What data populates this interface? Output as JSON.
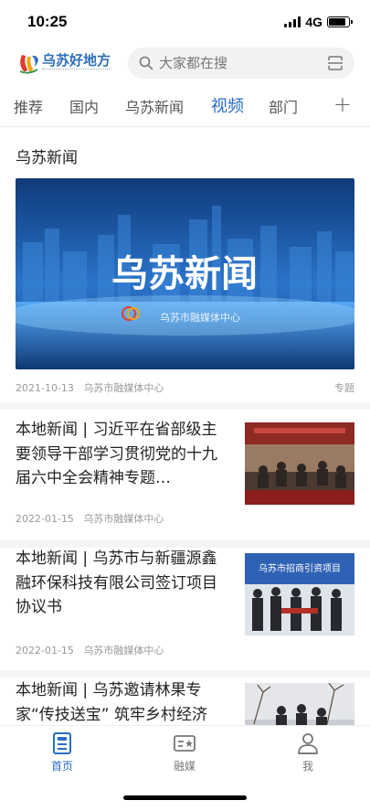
{
  "status_bar": {
    "time": "10:25",
    "network": "4G",
    "battery_level": 0.85
  },
  "header": {
    "logo_text": "乌苏好地方",
    "search_placeholder": "大家都在搜"
  },
  "tabs": [
    {
      "label": "推荐",
      "active": false
    },
    {
      "label": "国内",
      "active": false
    },
    {
      "label": "乌苏新闻",
      "active": false
    },
    {
      "label": "视频",
      "active": true
    },
    {
      "label": "部门",
      "active": false
    }
  ],
  "tabs_more": "+",
  "section": {
    "title": "乌苏新闻",
    "hero": {
      "headline": "乌苏新闻",
      "brand": "乌苏市融媒体中心",
      "date": "2021-10-13",
      "source": "乌苏市融媒体中心",
      "tag": "专题"
    }
  },
  "articles": [
    {
      "title": "本地新闻 | 习近平在省部级主要领导干部学习贯彻党的十九届六中全会精神专题…",
      "date": "2022-01-15",
      "source": "乌苏市融媒体中心",
      "thumb_banner": ""
    },
    {
      "title": "本地新闻 | 乌苏市与新疆源鑫融环保科技有限公司签订项目协议书",
      "date": "2022-01-15",
      "source": "乌苏市融媒体中心",
      "thumb_banner": "乌苏市招商引资项目"
    },
    {
      "title": "本地新闻 | 乌苏邀请林果专家“传技送宝” 筑牢乡村经济",
      "date": "",
      "source": "",
      "thumb_banner": ""
    }
  ],
  "bottom_nav": [
    {
      "label": "首页",
      "icon": "home-doc-icon",
      "active": true
    },
    {
      "label": "融媒",
      "icon": "media-star-icon",
      "active": false
    },
    {
      "label": "我",
      "icon": "user-icon",
      "active": false
    }
  ],
  "colors": {
    "accent": "#2a6dc4",
    "hero_bg": "#1a4f9e"
  }
}
